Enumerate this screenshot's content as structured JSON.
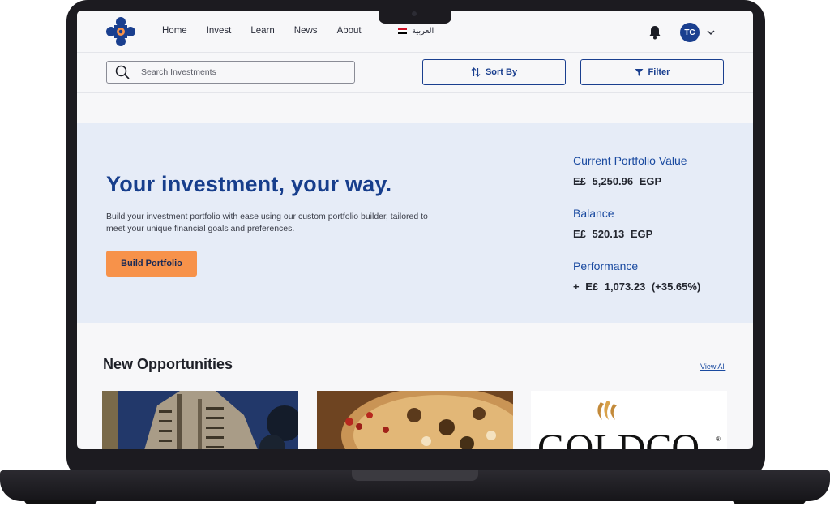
{
  "brand": {
    "logo_icon": "cross-logo-icon",
    "colors": {
      "primary": "#1a3f8f",
      "accent": "#f7924a",
      "hero_bg": "#e6ecf7"
    }
  },
  "nav": {
    "links": [
      "Home",
      "Invest",
      "Learn",
      "News",
      "About"
    ],
    "language": "العربية",
    "user_initials": "TC"
  },
  "toolbar": {
    "search_placeholder": "Search Investments",
    "sort_label": "Sort By",
    "filter_label": "Filter"
  },
  "hero": {
    "title": "Your investment, your way.",
    "description": "Build your investment portfolio with ease using our custom portfolio builder, tailored to meet your unique financial goals and preferences.",
    "button_label": "Build Portfolio",
    "stats": [
      {
        "label": "Current Portfolio Value",
        "value": "E£ 5,250.96  EGP"
      },
      {
        "label": "Balance",
        "value": "E£ 520.13  EGP"
      },
      {
        "label": "Performance",
        "value": "+ E£ 1,073.23  (+35.65%)"
      }
    ]
  },
  "opportunities": {
    "title": "New Opportunities",
    "view_all": "View All",
    "cards": [
      {
        "image": "building-photo"
      },
      {
        "image": "pizza-photo"
      },
      {
        "image": "goldco-logo",
        "logo_text": "GOLDCO"
      }
    ]
  }
}
